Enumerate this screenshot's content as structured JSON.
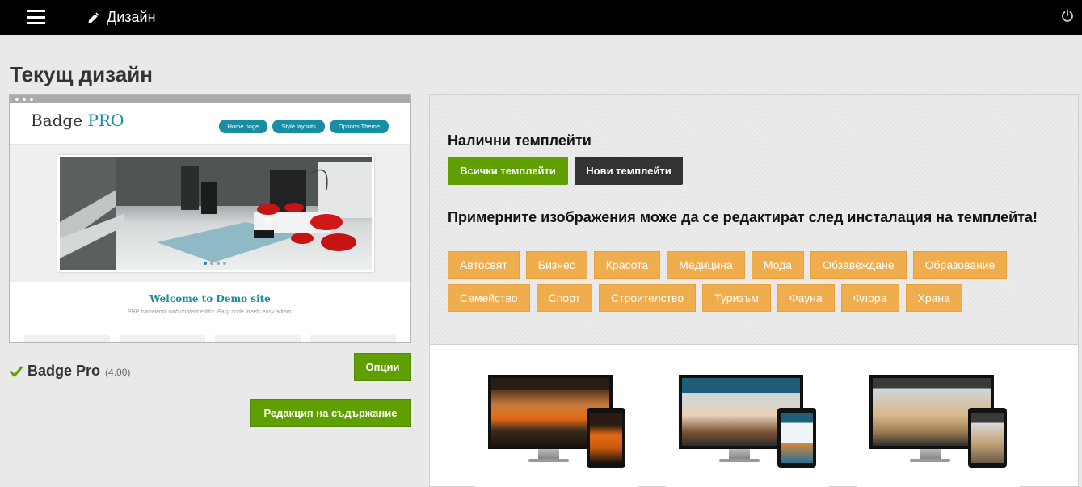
{
  "topbar": {
    "title": "Дизайн",
    "menu_icon": "hamburger-icon",
    "edit_icon": "pencil-icon",
    "power_icon": "power-icon"
  },
  "page_title": "Текущ дизайн",
  "preview": {
    "logo_main": "Badge",
    "logo_accent": "PRO",
    "nav": [
      "Home page",
      "Style layouts",
      "Options Theme"
    ],
    "welcome": "Welcome to Demo site",
    "subtitle": "PHP framework with content editor. Easy code meets easy admin."
  },
  "current_template": {
    "name": "Badge Pro",
    "version": "(4.00)",
    "options_label": "Опции",
    "edit_content_label": "Редакция на съдържание"
  },
  "templates": {
    "title": "Налични темплейти",
    "tabs": [
      {
        "label": "Всички темплейти",
        "active": true
      },
      {
        "label": "Нови темплейти",
        "active": false
      }
    ],
    "note": "Примерните изображения може да се редактират след инсталация на темплейта!",
    "categories": [
      "Автосвят",
      "Бизнес",
      "Красота",
      "Медицина",
      "Мода",
      "Обзавеждане",
      "Образование",
      "Семейство",
      "Спорт",
      "Строителство",
      "Туризъм",
      "Фауна",
      "Флора",
      "Храна"
    ]
  },
  "colors": {
    "topbar": "#000000",
    "green": "#5fa000",
    "dark": "#333333",
    "orange": "#f0ad4e",
    "teal": "#178ea3"
  }
}
